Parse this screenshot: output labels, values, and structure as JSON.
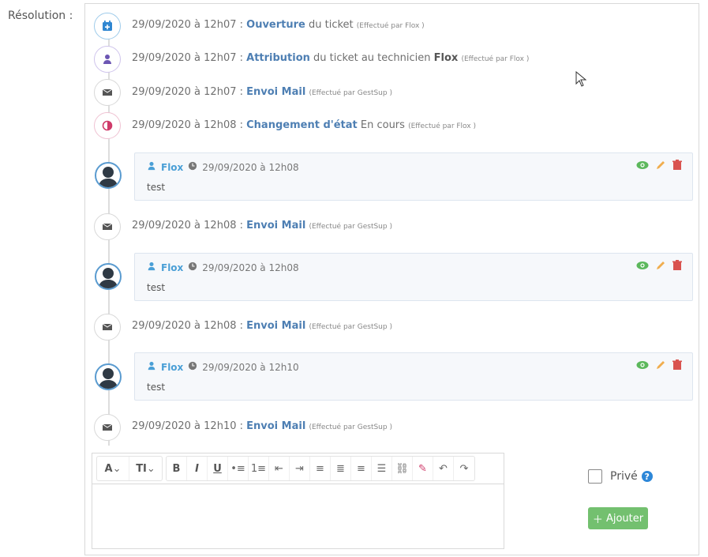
{
  "label": "Résolution :",
  "events": [
    {
      "date": "29/09/2020 à 12h07",
      "sep": " : ",
      "action": "Ouverture",
      "rest": " du ticket",
      "actor": "",
      "effect": "(Effectué par Flox )",
      "icon": "calendar-plus-icon",
      "icon_color": "#2f86d1",
      "border": "#9ecbea"
    },
    {
      "date": "29/09/2020 à 12h07",
      "sep": " : ",
      "action": "Attribution",
      "rest": " du ticket au technicien ",
      "actor": "Flox",
      "effect": "(Effectué par Flox )",
      "icon": "user-icon",
      "icon_color": "#6c56b3",
      "border": "#cfc4ec"
    },
    {
      "date": "29/09/2020 à 12h07",
      "sep": " : ",
      "action": "Envoi Mail",
      "rest": "",
      "actor": "",
      "effect": "(Effectué par GestSup )",
      "icon": "mail-icon",
      "icon_color": "#555555",
      "border": "#d8d8d8"
    },
    {
      "date": "29/09/2020 à 12h08",
      "sep": " : ",
      "action": "Changement d'état",
      "rest": " En cours",
      "actor": "",
      "effect": "(Effectué par Flox )",
      "icon": "half-circle-icon",
      "icon_color": "#cf3b6a",
      "border": "#efc2d2"
    }
  ],
  "comments": [
    {
      "user": "Flox",
      "time": "29/09/2020 à 12h08",
      "text": "test"
    },
    {
      "user": "Flox",
      "time": "29/09/2020 à 12h08",
      "text": "test"
    },
    {
      "user": "Flox",
      "time": "29/09/2020 à 12h10",
      "text": "test"
    }
  ],
  "mail_events": [
    {
      "date": "29/09/2020 à 12h08",
      "sep": " : ",
      "action": "Envoi Mail",
      "effect": "(Effectué par GestSup )"
    },
    {
      "date": "29/09/2020 à 12h08",
      "sep": " : ",
      "action": "Envoi Mail",
      "effect": "(Effectué par GestSup )"
    },
    {
      "date": "29/09/2020 à 12h10",
      "sep": " : ",
      "action": "Envoi Mail",
      "effect": "(Effectué par GestSup )"
    }
  ],
  "toolbar": {
    "items": [
      "A",
      "TI",
      "B",
      "I",
      "U",
      "bullet-list",
      "number-list",
      "outdent",
      "indent",
      "align-left",
      "align-center",
      "align-right",
      "align-justify",
      "link",
      "pen",
      "undo",
      "redo"
    ]
  },
  "controls": {
    "private_label": "Privé",
    "add_label": "Ajouter"
  },
  "colors": {
    "accent_blue": "#4e7fb3",
    "user_blue": "#4a9fd6",
    "eye_green": "#5cb85c",
    "edit_yellow": "#f0ad4e",
    "delete_red": "#d9534f",
    "add_green": "#73c06f"
  }
}
